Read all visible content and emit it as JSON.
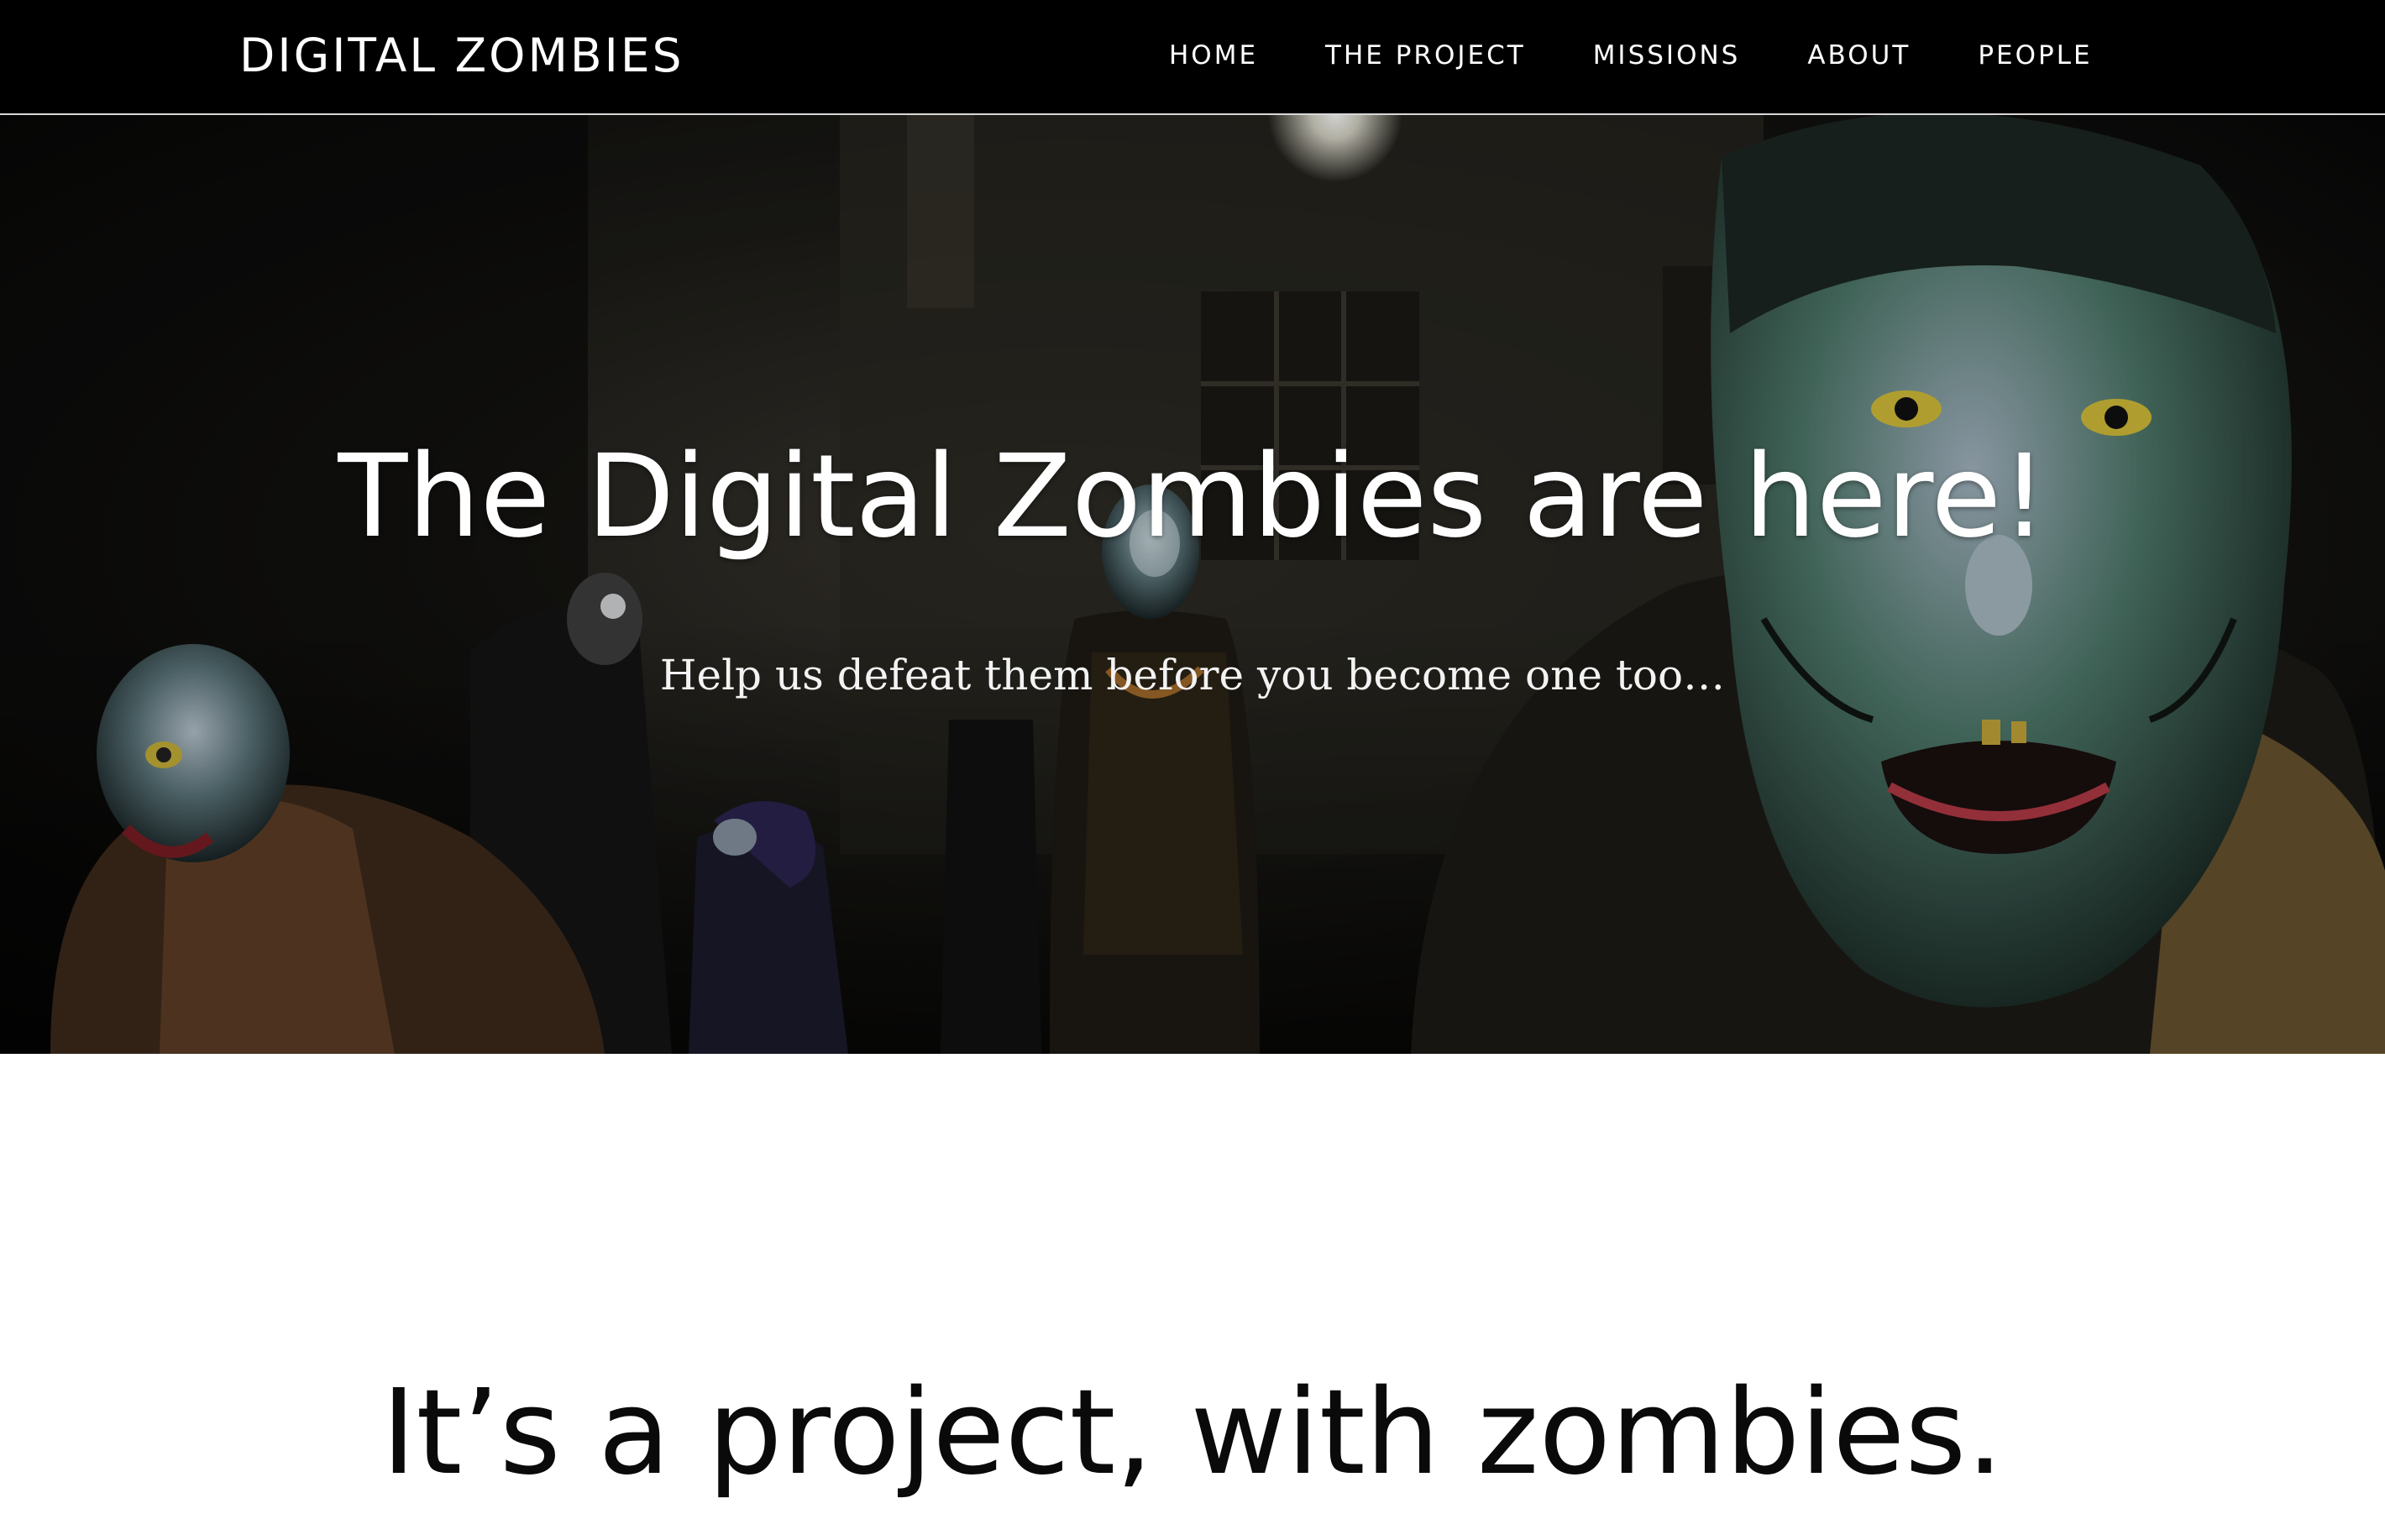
{
  "brand": {
    "name": "DIGITAL ZOMBIES"
  },
  "nav": {
    "items": [
      {
        "label": "HOME"
      },
      {
        "label": "THE PROJECT"
      },
      {
        "label": "MISSIONS"
      },
      {
        "label": "ABOUT"
      },
      {
        "label": "PEOPLE"
      }
    ]
  },
  "hero": {
    "title": "The Digital Zombies are here!",
    "subtitle": "Help us defeat them before you become one too…"
  },
  "section": {
    "heading": "It’s a project, with zombies."
  },
  "colors": {
    "navbar_bg": "#000000",
    "text_light": "#ffffff",
    "text_dark": "#0a0a0a",
    "page_bg": "#ffffff"
  }
}
